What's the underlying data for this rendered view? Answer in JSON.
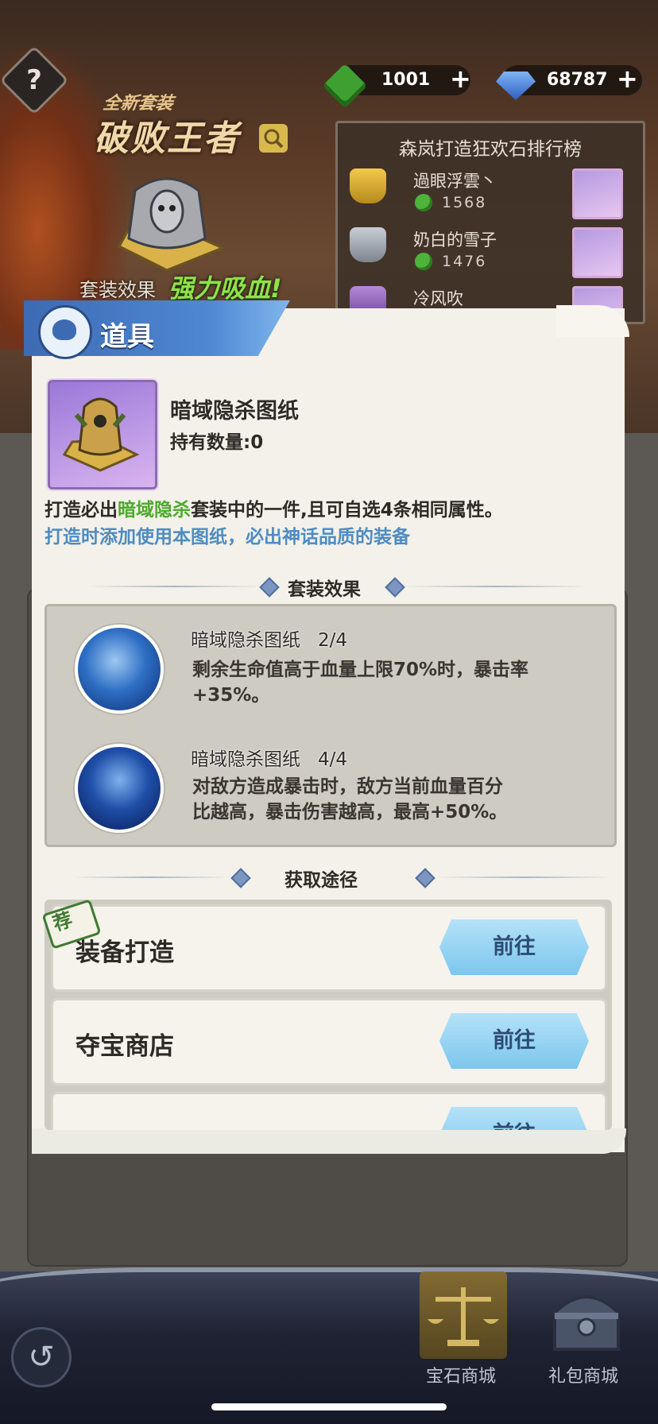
{
  "help": {
    "label": "?"
  },
  "currency": {
    "gems": {
      "value": "1001",
      "plus": "+",
      "icon": "green-gem-icon"
    },
    "diamonds": {
      "value": "68787",
      "plus": "+",
      "icon": "blue-diamond-icon"
    }
  },
  "promo": {
    "subtitle": "全新套装",
    "title": "破败王者",
    "set_effect_label": "套装效果",
    "set_effect_value": "强力吸血!"
  },
  "ranking": {
    "title": "森岚打造狂欢石排行榜",
    "entries": [
      {
        "name": "過眼浮雲丶",
        "score": "1568"
      },
      {
        "name": "奶白的雪子",
        "score": "1476"
      },
      {
        "name": "冷风吹",
        "score": ""
      }
    ]
  },
  "modal": {
    "title": "道具",
    "item": {
      "name": "暗域隐杀图纸",
      "quantity_label": "持有数量:",
      "quantity": "0"
    },
    "description": {
      "line1_prefix": "打造必出",
      "line1_highlight": "暗域隐杀",
      "line1_suffix": "套装中的一件,且可自选4条相同属性。",
      "line2": "打造时添加使用本图纸，必出神话品质的装备"
    },
    "set_effects": {
      "header": "套装效果",
      "items": [
        {
          "name": "暗域隐杀图纸",
          "count": "2/4",
          "line1": "剩余生命值高于血量上限70%时，暴击率",
          "line2": "+35%。"
        },
        {
          "name": "暗域隐杀图纸",
          "count": "4/4",
          "line1": "对敌方造成暴击时，敌方当前血量百分",
          "line2": "比越高，暴击伤害越高，最高+50%。"
        }
      ]
    },
    "acquire": {
      "header": "获取途径",
      "badge": "荐",
      "rows": [
        {
          "name": "装备打造",
          "button": "前往"
        },
        {
          "name": "夺宝商店",
          "button": "前往"
        },
        {
          "name": "",
          "button": "前往"
        }
      ]
    }
  },
  "bottom_nav": {
    "back": "↺",
    "tabs": [
      {
        "label": "宝石商城",
        "icon": "scale-icon"
      },
      {
        "label": "礼包商城",
        "icon": "chest-icon"
      }
    ]
  },
  "colors": {
    "accent_blue": "#4f88d3",
    "highlight_green": "#4caa2d",
    "hint_blue": "#4d8cc2",
    "button_blue": "#7cc6ee"
  }
}
